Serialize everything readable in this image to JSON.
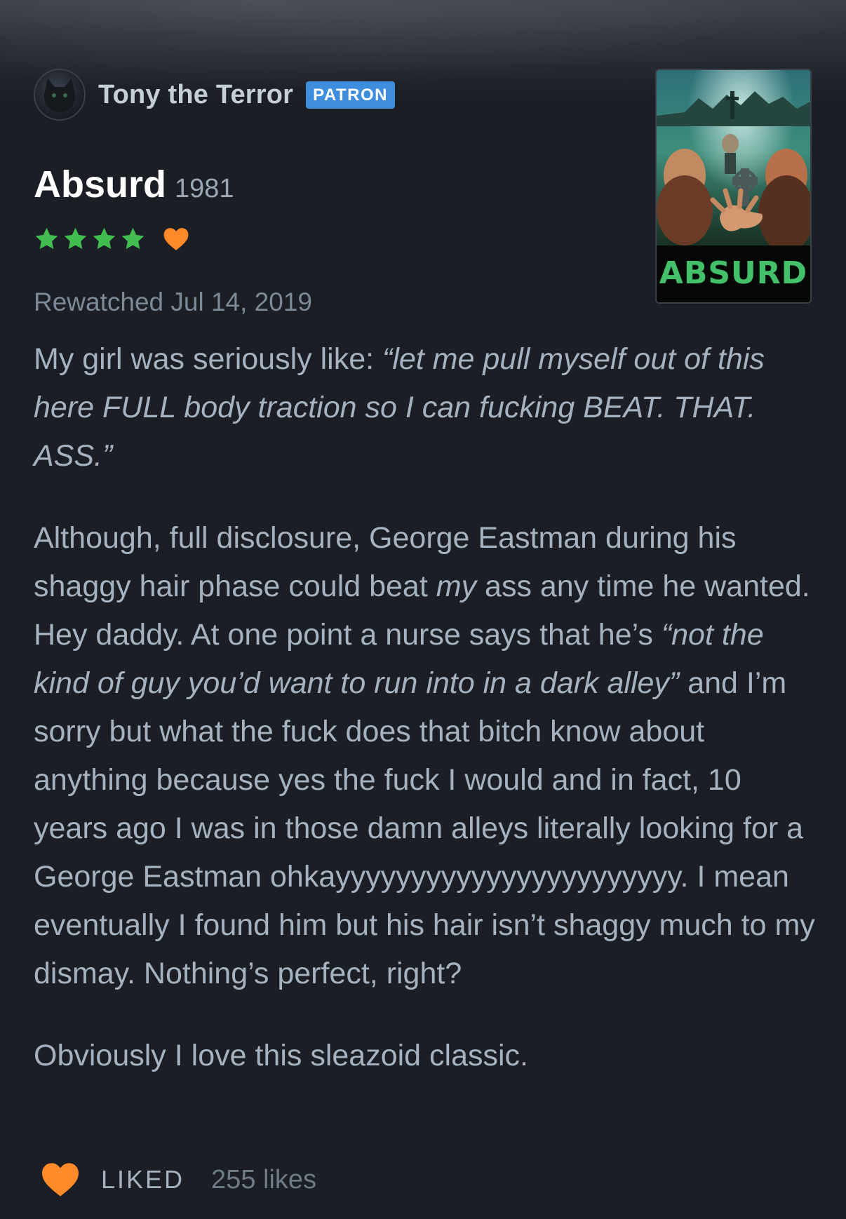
{
  "header": {
    "username": "Tony the Terror",
    "badge": "PATRON"
  },
  "film": {
    "title": "Absurd",
    "year": "1981",
    "poster_title": "ABSURD",
    "rating_stars": 4,
    "liked": true
  },
  "watched_label": "Rewatched Jul 14, 2019",
  "review": {
    "p1_plain": "My girl was seriously like: ",
    "p1_quote": "“let me pull myself out of this here FULL body traction so I can fucking BEAT. THAT. ASS.”",
    "p2_a": "Although, full disclosure, George Eastman during his shaggy hair phase could beat ",
    "p2_b": "my",
    "p2_c": " ass any time he wanted. Hey daddy. At one point a nurse says that he’s ",
    "p2_d": "“not the kind of guy you’d want to run into in a dark alley”",
    "p2_e": " and I’m sorry but what the fuck does that bitch know about anything because yes the fuck I would and in fact, 10 years ago I was in those damn alleys literally looking for a George Eastman ohkayyyyyyyyyyyyyyyyyyyyyyy. I mean eventually I found him but his hair isn’t shaggy much to my dismay. Nothing’s perfect, right?",
    "p3": "Obviously I love this sleazoid classic."
  },
  "footer": {
    "liked_label": "LIKED",
    "likes_count": "255 likes"
  },
  "colors": {
    "star": "#40bd4e",
    "heart": "#ff8a2a",
    "badge": "#3f8ede",
    "background": "#1b1e24"
  }
}
